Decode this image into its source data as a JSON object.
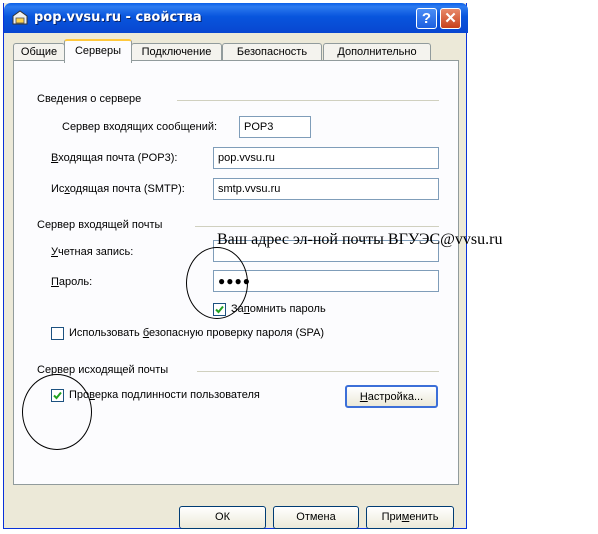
{
  "window": {
    "title": "pop.vvsu.ru - свойства",
    "help_label": "?",
    "close_label": "✕",
    "icon": "mail-server-icon"
  },
  "tabs": [
    {
      "label": "Общие",
      "active": false
    },
    {
      "label": "Серверы",
      "active": true
    },
    {
      "label": "Подключение",
      "active": false
    },
    {
      "label": "Безопасность",
      "active": false
    },
    {
      "label": "Дополнительно",
      "active": false
    }
  ],
  "server_info": {
    "group_label": "Сведения о сервере",
    "incoming_type_label": "Сервер входящих сообщений:",
    "incoming_type_value": "POP3",
    "incoming_label_pre": "",
    "incoming_label_ul": "В",
    "incoming_label_post": "ходящая почта (POP3):",
    "incoming_value": "pop.vvsu.ru",
    "outgoing_label_pre": "Ис",
    "outgoing_label_ul": "х",
    "outgoing_label_post": "одящая почта (SMTP):",
    "outgoing_value": "smtp.vvsu.ru"
  },
  "incoming_server": {
    "group_label": "Сервер входящей почты",
    "account_label_ul": "У",
    "account_label_post": "четная запись:",
    "account_value": "",
    "password_label_ul": "П",
    "password_label_post": "ароль:",
    "password_value": "●●●●",
    "remember_pre": "За",
    "remember_ul": "п",
    "remember_post": "омнить пароль",
    "remember_checked": true,
    "spa_pre": "Использовать ",
    "spa_ul": "б",
    "spa_post": "езопасную проверку пароля (SPA)",
    "spa_checked": false
  },
  "outgoing_server": {
    "group_label": "Сервер исходящей почты",
    "auth_pre": "Про",
    "auth_ul": "в",
    "auth_post": "ерка подлинности пользователя",
    "auth_checked": true,
    "settings_ul": "Н",
    "settings_post": "астройка..."
  },
  "buttons": {
    "ok": "ОК",
    "cancel": "Отмена",
    "apply_pre": "При",
    "apply_ul": "м",
    "apply_post": "енить"
  },
  "annotation": "Ваш адрес эл-ной почты ВГУЭС@vvsu.ru"
}
